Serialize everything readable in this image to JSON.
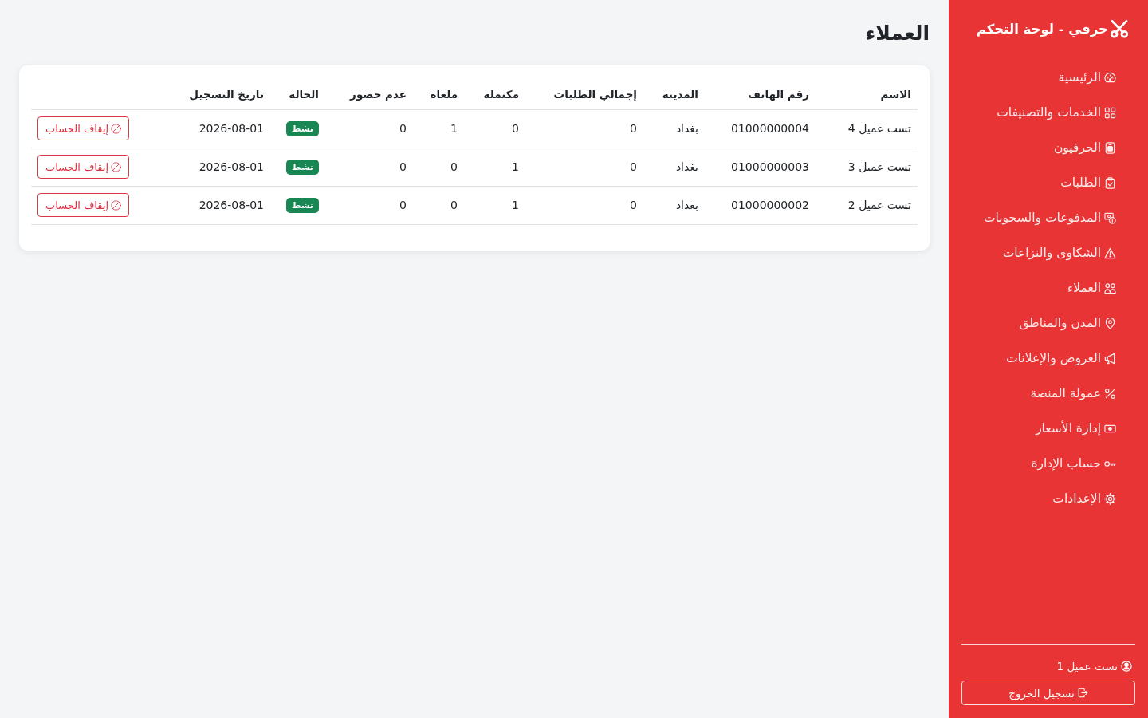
{
  "sidebar": {
    "brand": "حرفي - لوحة التحكم",
    "items": [
      {
        "label": "الرئيسية"
      },
      {
        "label": "الخدمات والتصنيفات"
      },
      {
        "label": "الحرفيون"
      },
      {
        "label": "الطلبات"
      },
      {
        "label": "المدفوعات والسحوبات"
      },
      {
        "label": "الشكاوى والنزاعات"
      },
      {
        "label": "العملاء"
      },
      {
        "label": "المدن والمناطق"
      },
      {
        "label": "العروض والإعلانات"
      },
      {
        "label": "عمولة المنصة"
      },
      {
        "label": "إدارة الأسعار"
      },
      {
        "label": "حساب الإدارة"
      },
      {
        "label": "الإعدادات"
      }
    ],
    "user": "تست عميل 1",
    "logout": "تسجيل الخروج"
  },
  "page_title": "العملاء",
  "table": {
    "columns": [
      "الاسم",
      "رقم الهاتف",
      "المدينة",
      "إجمالي الطلبات",
      "مكتملة",
      "ملغاة",
      "عدم حضور",
      "الحالة",
      "تاريخ التسجيل"
    ],
    "rows": [
      {
        "name": "تست عميل 4",
        "phone": "01000000004",
        "city": "بغداد",
        "total_orders": "0",
        "completed": "0",
        "cancelled": "1",
        "no_show": "0",
        "status": "نشط",
        "registered": "2026-08-01",
        "action": "إيقاف الحساب"
      },
      {
        "name": "تست عميل 3",
        "phone": "01000000003",
        "city": "بغداد",
        "total_orders": "0",
        "completed": "1",
        "cancelled": "0",
        "no_show": "0",
        "status": "نشط",
        "registered": "2026-08-01",
        "action": "إيقاف الحساب"
      },
      {
        "name": "تست عميل 2",
        "phone": "01000000002",
        "city": "بغداد",
        "total_orders": "0",
        "completed": "1",
        "cancelled": "0",
        "no_show": "0",
        "status": "نشط",
        "registered": "2026-08-01",
        "action": "إيقاف الحساب"
      }
    ]
  }
}
